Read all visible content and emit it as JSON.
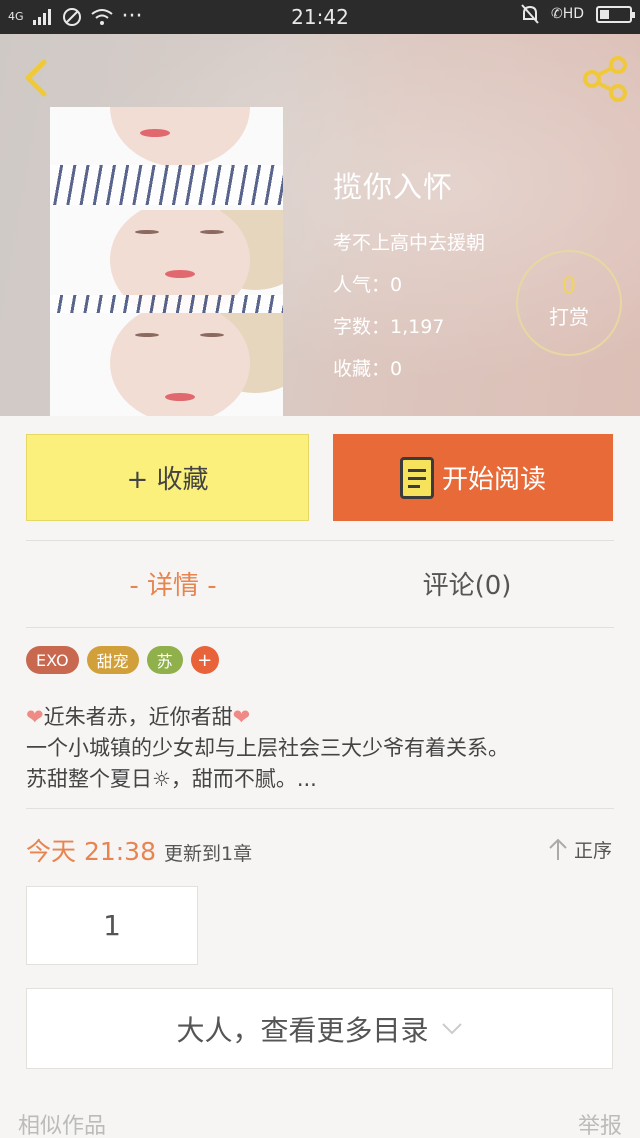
{
  "status_bar": {
    "network": "4G",
    "time": "21:42",
    "more": "···",
    "call_status": "HD"
  },
  "book": {
    "title": "揽你入怀",
    "author": "考不上高中去援朝",
    "popularity": "人气：0",
    "word_count": "字数：1,197",
    "favorites": "收藏：0"
  },
  "tip": {
    "count": "0",
    "label": "打赏"
  },
  "actions": {
    "collect_label": "+ 收藏",
    "read_label": "开始阅读"
  },
  "tabs": {
    "detail": "- 详情 -",
    "comments": "评论(0)"
  },
  "tags": [
    {
      "label": "EXO",
      "color": "#c8684f"
    },
    {
      "label": "甜宠",
      "color": "#d2a03b"
    },
    {
      "label": "苏",
      "color": "#8fb04b"
    }
  ],
  "tag_add_label": "+",
  "description": {
    "line1": "近朱者赤，近你者甜",
    "line2": "一个小城镇的少女却与上层社会三大少爷有着关系。",
    "line3": "苏甜整个夏日☼，甜而不腻。..."
  },
  "update": {
    "time": "今天 21:38",
    "text": "更新到1章"
  },
  "order_label": "正序",
  "chapter_number": "1",
  "more_catalog_label": "大人，查看更多目录",
  "footer": {
    "similar": "相似作品",
    "report": "举报"
  }
}
